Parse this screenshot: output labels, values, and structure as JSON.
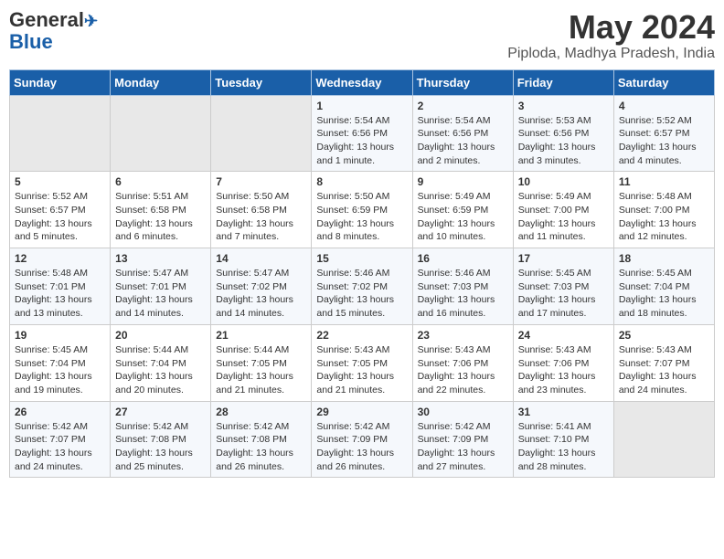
{
  "header": {
    "logo_line1": "General",
    "logo_line2": "Blue",
    "month_title": "May 2024",
    "location": "Piploda, Madhya Pradesh, India"
  },
  "weekdays": [
    "Sunday",
    "Monday",
    "Tuesday",
    "Wednesday",
    "Thursday",
    "Friday",
    "Saturday"
  ],
  "weeks": [
    [
      {
        "day": "",
        "info": ""
      },
      {
        "day": "",
        "info": ""
      },
      {
        "day": "",
        "info": ""
      },
      {
        "day": "1",
        "info": "Sunrise: 5:54 AM\nSunset: 6:56 PM\nDaylight: 13 hours\nand 1 minute."
      },
      {
        "day": "2",
        "info": "Sunrise: 5:54 AM\nSunset: 6:56 PM\nDaylight: 13 hours\nand 2 minutes."
      },
      {
        "day": "3",
        "info": "Sunrise: 5:53 AM\nSunset: 6:56 PM\nDaylight: 13 hours\nand 3 minutes."
      },
      {
        "day": "4",
        "info": "Sunrise: 5:52 AM\nSunset: 6:57 PM\nDaylight: 13 hours\nand 4 minutes."
      }
    ],
    [
      {
        "day": "5",
        "info": "Sunrise: 5:52 AM\nSunset: 6:57 PM\nDaylight: 13 hours\nand 5 minutes."
      },
      {
        "day": "6",
        "info": "Sunrise: 5:51 AM\nSunset: 6:58 PM\nDaylight: 13 hours\nand 6 minutes."
      },
      {
        "day": "7",
        "info": "Sunrise: 5:50 AM\nSunset: 6:58 PM\nDaylight: 13 hours\nand 7 minutes."
      },
      {
        "day": "8",
        "info": "Sunrise: 5:50 AM\nSunset: 6:59 PM\nDaylight: 13 hours\nand 8 minutes."
      },
      {
        "day": "9",
        "info": "Sunrise: 5:49 AM\nSunset: 6:59 PM\nDaylight: 13 hours\nand 10 minutes."
      },
      {
        "day": "10",
        "info": "Sunrise: 5:49 AM\nSunset: 7:00 PM\nDaylight: 13 hours\nand 11 minutes."
      },
      {
        "day": "11",
        "info": "Sunrise: 5:48 AM\nSunset: 7:00 PM\nDaylight: 13 hours\nand 12 minutes."
      }
    ],
    [
      {
        "day": "12",
        "info": "Sunrise: 5:48 AM\nSunset: 7:01 PM\nDaylight: 13 hours\nand 13 minutes."
      },
      {
        "day": "13",
        "info": "Sunrise: 5:47 AM\nSunset: 7:01 PM\nDaylight: 13 hours\nand 14 minutes."
      },
      {
        "day": "14",
        "info": "Sunrise: 5:47 AM\nSunset: 7:02 PM\nDaylight: 13 hours\nand 14 minutes."
      },
      {
        "day": "15",
        "info": "Sunrise: 5:46 AM\nSunset: 7:02 PM\nDaylight: 13 hours\nand 15 minutes."
      },
      {
        "day": "16",
        "info": "Sunrise: 5:46 AM\nSunset: 7:03 PM\nDaylight: 13 hours\nand 16 minutes."
      },
      {
        "day": "17",
        "info": "Sunrise: 5:45 AM\nSunset: 7:03 PM\nDaylight: 13 hours\nand 17 minutes."
      },
      {
        "day": "18",
        "info": "Sunrise: 5:45 AM\nSunset: 7:04 PM\nDaylight: 13 hours\nand 18 minutes."
      }
    ],
    [
      {
        "day": "19",
        "info": "Sunrise: 5:45 AM\nSunset: 7:04 PM\nDaylight: 13 hours\nand 19 minutes."
      },
      {
        "day": "20",
        "info": "Sunrise: 5:44 AM\nSunset: 7:04 PM\nDaylight: 13 hours\nand 20 minutes."
      },
      {
        "day": "21",
        "info": "Sunrise: 5:44 AM\nSunset: 7:05 PM\nDaylight: 13 hours\nand 21 minutes."
      },
      {
        "day": "22",
        "info": "Sunrise: 5:43 AM\nSunset: 7:05 PM\nDaylight: 13 hours\nand 21 minutes."
      },
      {
        "day": "23",
        "info": "Sunrise: 5:43 AM\nSunset: 7:06 PM\nDaylight: 13 hours\nand 22 minutes."
      },
      {
        "day": "24",
        "info": "Sunrise: 5:43 AM\nSunset: 7:06 PM\nDaylight: 13 hours\nand 23 minutes."
      },
      {
        "day": "25",
        "info": "Sunrise: 5:43 AM\nSunset: 7:07 PM\nDaylight: 13 hours\nand 24 minutes."
      }
    ],
    [
      {
        "day": "26",
        "info": "Sunrise: 5:42 AM\nSunset: 7:07 PM\nDaylight: 13 hours\nand 24 minutes."
      },
      {
        "day": "27",
        "info": "Sunrise: 5:42 AM\nSunset: 7:08 PM\nDaylight: 13 hours\nand 25 minutes."
      },
      {
        "day": "28",
        "info": "Sunrise: 5:42 AM\nSunset: 7:08 PM\nDaylight: 13 hours\nand 26 minutes."
      },
      {
        "day": "29",
        "info": "Sunrise: 5:42 AM\nSunset: 7:09 PM\nDaylight: 13 hours\nand 26 minutes."
      },
      {
        "day": "30",
        "info": "Sunrise: 5:42 AM\nSunset: 7:09 PM\nDaylight: 13 hours\nand 27 minutes."
      },
      {
        "day": "31",
        "info": "Sunrise: 5:41 AM\nSunset: 7:10 PM\nDaylight: 13 hours\nand 28 minutes."
      },
      {
        "day": "",
        "info": ""
      }
    ]
  ]
}
